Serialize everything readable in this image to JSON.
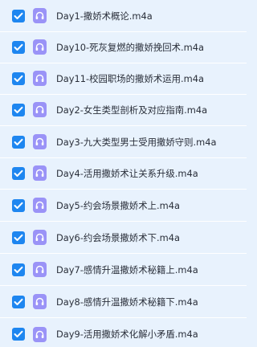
{
  "files": [
    {
      "name": "Day1-撒娇术概论.m4a",
      "checked": true,
      "icon": "audio-file-icon"
    },
    {
      "name": "Day10-死灰复燃的撒娇挽回术.m4a",
      "checked": true,
      "icon": "audio-file-icon"
    },
    {
      "name": "Day11-校园职场的撒娇术运用.m4a",
      "checked": true,
      "icon": "audio-file-icon"
    },
    {
      "name": "Day2-女生类型剖析及对应指南.m4a",
      "checked": true,
      "icon": "audio-file-icon"
    },
    {
      "name": "Day3-九大类型男士受用撒娇守则.m4a",
      "checked": true,
      "icon": "audio-file-icon"
    },
    {
      "name": "Day4-活用撒娇术让关系升级.m4a",
      "checked": true,
      "icon": "audio-file-icon"
    },
    {
      "name": "Day5-约会场景撒娇术上.m4a",
      "checked": true,
      "icon": "audio-file-icon"
    },
    {
      "name": "Day6-约会场景撒娇术下.m4a",
      "checked": true,
      "icon": "audio-file-icon"
    },
    {
      "name": "Day7-感情升温撒娇术秘籍上.m4a",
      "checked": true,
      "icon": "audio-file-icon"
    },
    {
      "name": "Day8-感情升温撒娇术秘籍下.m4a",
      "checked": true,
      "icon": "audio-file-icon"
    },
    {
      "name": "Day9-活用撒娇术化解小矛盾.m4a",
      "checked": true,
      "icon": "audio-file-icon"
    }
  ],
  "colors": {
    "row_background": "#e8f2fd",
    "checkbox": "#1e86f0",
    "audio_icon": "#9a93f7",
    "text": "#2a2f3a"
  }
}
